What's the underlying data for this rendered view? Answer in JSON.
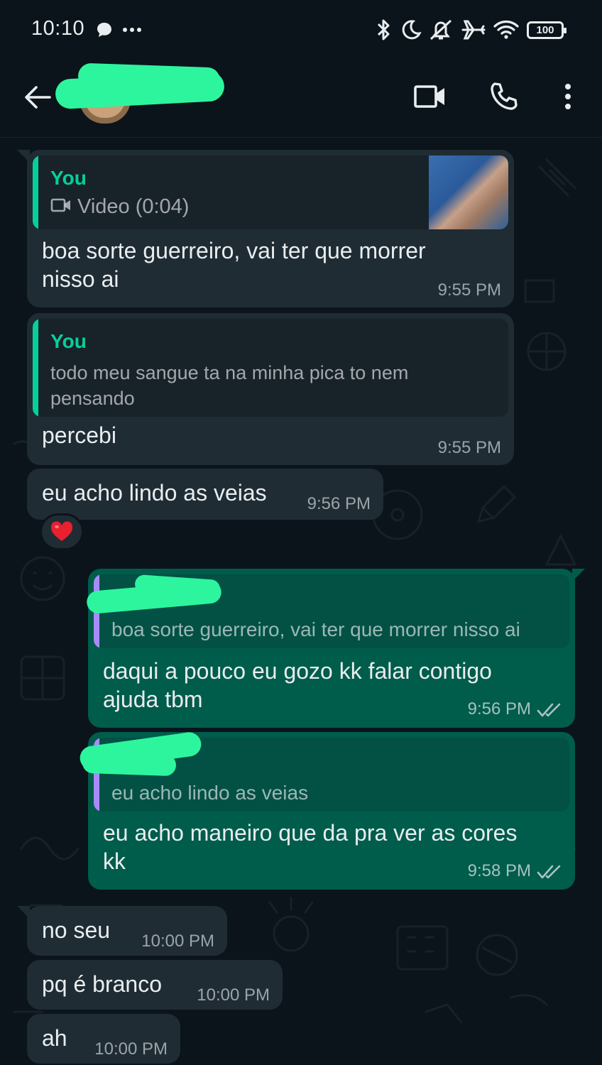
{
  "status_bar": {
    "time": "10:10",
    "battery": "100"
  },
  "header": {
    "back_icon": "arrow-left-icon",
    "video_icon": "video-call-icon",
    "call_icon": "phone-icon",
    "menu_icon": "more-vertical-icon"
  },
  "colors": {
    "background": "#0b141a",
    "incoming_bubble": "#1f2c34",
    "outgoing_bubble": "#005c4b",
    "quote_accent_green": "#06cf9c",
    "quote_accent_purple": "#a78bfa",
    "redaction": "#2df59e"
  },
  "messages": [
    {
      "direction": "incoming",
      "quote": {
        "author": "You",
        "text": "Video (0:04)",
        "icon": "video-icon",
        "has_thumbnail": true
      },
      "text": "boa sorte guerreiro, vai ter que morrer",
      "text_line2": "nisso ai",
      "time": "9:55 PM"
    },
    {
      "direction": "incoming",
      "quote": {
        "author": "You",
        "text": "todo meu sangue ta na minha pica to nem",
        "text_line2": "pensando"
      },
      "text": "percebi",
      "time": "9:55 PM"
    },
    {
      "direction": "incoming",
      "text": "eu acho lindo as veias",
      "time": "9:56 PM",
      "reaction": "❤️"
    },
    {
      "direction": "outgoing",
      "quote": {
        "text": "boa sorte guerreiro, vai ter que morrer nisso ai"
      },
      "text": "daqui a pouco eu gozo kk falar contigo",
      "text_line2": "ajuda tbm",
      "time": "9:56 PM",
      "status": "read"
    },
    {
      "direction": "outgoing",
      "quote": {
        "text": "eu acho lindo as veias"
      },
      "text": "eu acho maneiro que da pra ver as cores",
      "text_line2": "kk",
      "time": "9:58 PM",
      "status": "read"
    },
    {
      "direction": "incoming",
      "text": "no seu",
      "time": "10:00 PM"
    },
    {
      "direction": "incoming",
      "text": "pq é branco",
      "time": "10:00 PM"
    },
    {
      "direction": "incoming",
      "text": "ah",
      "time": "10:00 PM"
    }
  ]
}
